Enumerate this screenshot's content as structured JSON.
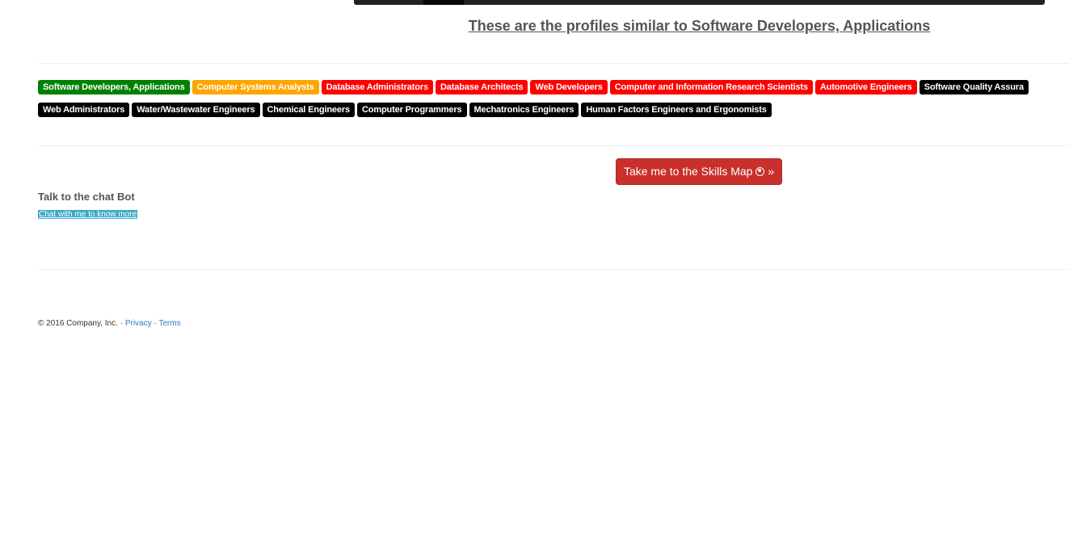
{
  "headline": "These are the profiles similar to Software Developers, Applications",
  "colors": {
    "green": "#008000",
    "orange": "#ffa500",
    "red": "#ff0000",
    "black": "#000000",
    "button_red": "#c9302c",
    "chat_link_bg": "#3ba8c8",
    "footer_link": "#337ab7"
  },
  "tag_rows": [
    [
      {
        "label": "Software Developers, Applications",
        "color": "#008000"
      },
      {
        "label": "Computer Systems Analysts",
        "color": "#ffa500"
      },
      {
        "label": "Database Administrators",
        "color": "#ff0000"
      },
      {
        "label": "Database Architects",
        "color": "#ff0000"
      },
      {
        "label": "Web Developers",
        "color": "#ff0000"
      },
      {
        "label": "Computer and Information Research Scientists",
        "color": "#ff0000"
      },
      {
        "label": "Automotive Engineers",
        "color": "#ff0000"
      },
      {
        "label": "Software Quality Assura",
        "color": "#000000"
      }
    ],
    [
      {
        "label": "Web Administrators",
        "color": "#000000"
      },
      {
        "label": "Water/Wastewater Engineers",
        "color": "#000000"
      },
      {
        "label": "Chemical Engineers",
        "color": "#000000"
      },
      {
        "label": "Computer Programmers",
        "color": "#000000"
      },
      {
        "label": "Mechatronics Engineers",
        "color": "#000000"
      },
      {
        "label": "Human Factors Engineers and Ergonomists",
        "color": "#000000"
      }
    ]
  ],
  "skills_button": {
    "label": "Take me to the Skills Map",
    "icon": "globe-icon",
    "suffix": "»"
  },
  "chat": {
    "title": "Talk to the chat Bot",
    "link": "Chat with me to know more"
  },
  "footer": {
    "copyright": "© 2016 Company, Inc.",
    "separator": "·",
    "privacy": "Privacy",
    "terms": "Terms"
  }
}
